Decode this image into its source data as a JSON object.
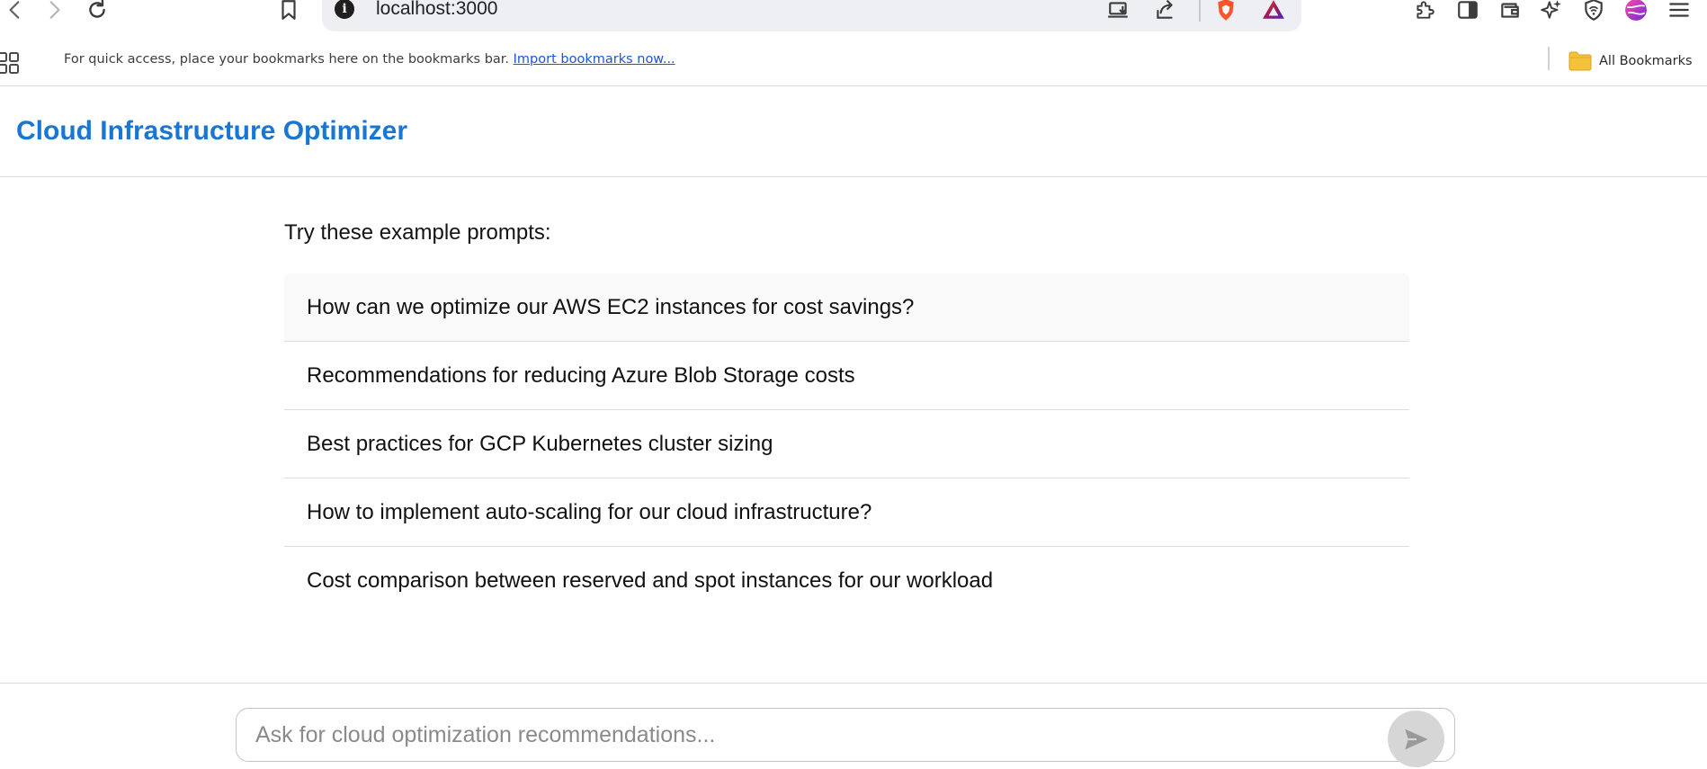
{
  "browser": {
    "url": "localhost:3000",
    "bookmarks_bar": {
      "message": "For quick access, place your bookmarks here on the bookmarks bar.",
      "import_link": "Import bookmarks now...",
      "all_bookmarks": "All Bookmarks"
    },
    "icons": [
      "back-icon",
      "forward-icon",
      "reload-icon",
      "bookmark-icon",
      "site-info-icon",
      "install-app-icon",
      "share-icon",
      "brave-shields-icon",
      "brave-rewards-icon",
      "extensions-icon",
      "sidebar-icon",
      "wallet-icon",
      "leo-ai-icon",
      "vpn-icon",
      "profile-avatar-icon",
      "menu-icon",
      "apps-icon",
      "folder-icon"
    ]
  },
  "app": {
    "title": "Cloud Infrastructure Optimizer",
    "examples_heading": "Try these example prompts:",
    "prompts": [
      "How can we optimize our AWS EC2 instances for cost savings?",
      "Recommendations for reducing Azure Blob Storage costs",
      "Best practices for GCP Kubernetes cluster sizing",
      "How to implement auto-scaling for our cloud infrastructure?",
      "Cost comparison between reserved and spot instances for our workload"
    ],
    "input": {
      "value": "",
      "placeholder": "Ask for cloud optimization recommendations..."
    }
  },
  "colors": {
    "title_accent": "#1976d2",
    "send_button_bg": "#d6d6d6",
    "link": "#1a56d6",
    "brave_orange": "#fb542b"
  }
}
